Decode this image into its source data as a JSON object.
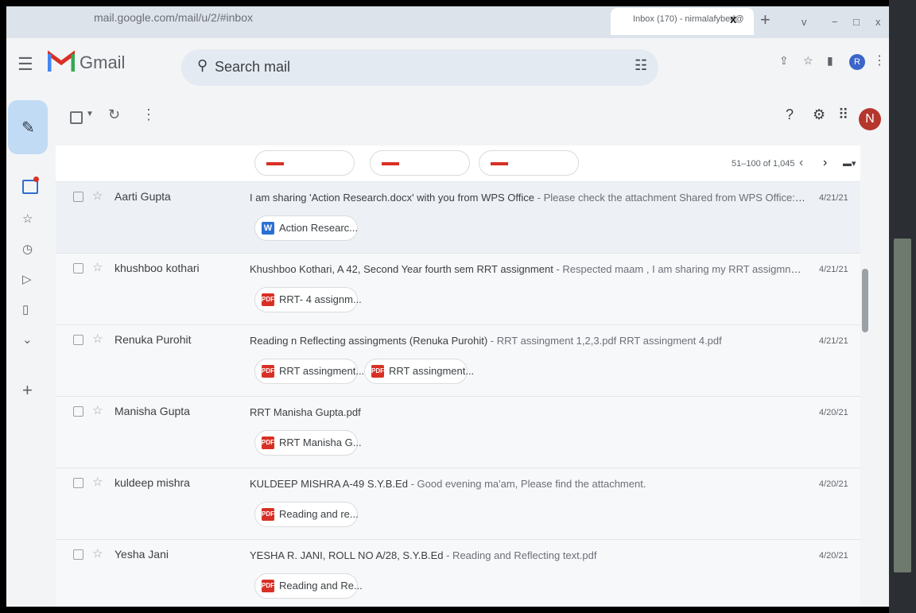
{
  "browser": {
    "url": "mail.google.com/mail/u/2/#inbox",
    "tab_title": "Inbox (170) - nirmalafybed@",
    "tab_close": "x",
    "new_tab": "+",
    "min": "−",
    "restore": "□",
    "close": "x",
    "chevron": "v",
    "profile_initial": "R"
  },
  "gmail": {
    "logo_text": "Gmail",
    "search_placeholder": "Search mail",
    "account_initial": "N"
  },
  "pagination": {
    "range": "51–100 of 1,045"
  },
  "emails": [
    {
      "sender": "Aarti Gupta",
      "subject": "I am sharing 'Action Research.docx' with you from WPS Office",
      "snippet": " - Please check the attachment Shared from WPS Office: https://kso.page.li...",
      "date": "4/21/21",
      "attachments": [
        {
          "label": "Action Researc...",
          "type": "word",
          "icon_text": "W"
        }
      ]
    },
    {
      "sender": "khushboo kothari",
      "subject": "Khushboo Kothari, A 42, Second Year fourth sem RRT assignment",
      "snippet": " - Respected maam , I am sharing my RRT assigmnents as attachment . ...",
      "date": "4/21/21",
      "attachments": [
        {
          "label": "RRT- 4 assignm...",
          "type": "pdf",
          "icon_text": "PDF"
        }
      ]
    },
    {
      "sender": "Renuka Purohit",
      "subject": "Reading n Reflecting assingments (Renuka Purohit)",
      "snippet": " - RRT assingment 1,2,3.pdf RRT assingment 4.pdf",
      "date": "4/21/21",
      "attachments": [
        {
          "label": "RRT assingment...",
          "type": "pdf",
          "icon_text": "PDF"
        },
        {
          "label": "RRT assingment...",
          "type": "pdf",
          "icon_text": "PDF"
        }
      ]
    },
    {
      "sender": "Manisha Gupta",
      "subject": "RRT Manisha Gupta.pdf",
      "snippet": "",
      "date": "4/20/21",
      "attachments": [
        {
          "label": "RRT Manisha G...",
          "type": "pdf",
          "icon_text": "PDF"
        }
      ]
    },
    {
      "sender": "kuldeep mishra",
      "subject": "KULDEEP MISHRA A-49 S.Y.B.Ed",
      "snippet": " - Good evening ma'am, Please find the attachment.",
      "date": "4/20/21",
      "attachments": [
        {
          "label": "Reading and re...",
          "type": "pdf",
          "icon_text": "PDF"
        }
      ]
    },
    {
      "sender": "Yesha Jani",
      "subject": "YESHA R. JANI, ROLL NO A/28, S.Y.B.Ed",
      "snippet": " - Reading and Reflecting text.pdf",
      "date": "4/20/21",
      "attachments": [
        {
          "label": "Reading and Re...",
          "type": "pdf",
          "icon_text": "PDF"
        }
      ]
    }
  ],
  "colors": {
    "pdf_red": "#d93025",
    "word_blue": "#2b6fd6",
    "compose_bg": "#c2dbf5",
    "avatar_red": "#b5362d"
  }
}
